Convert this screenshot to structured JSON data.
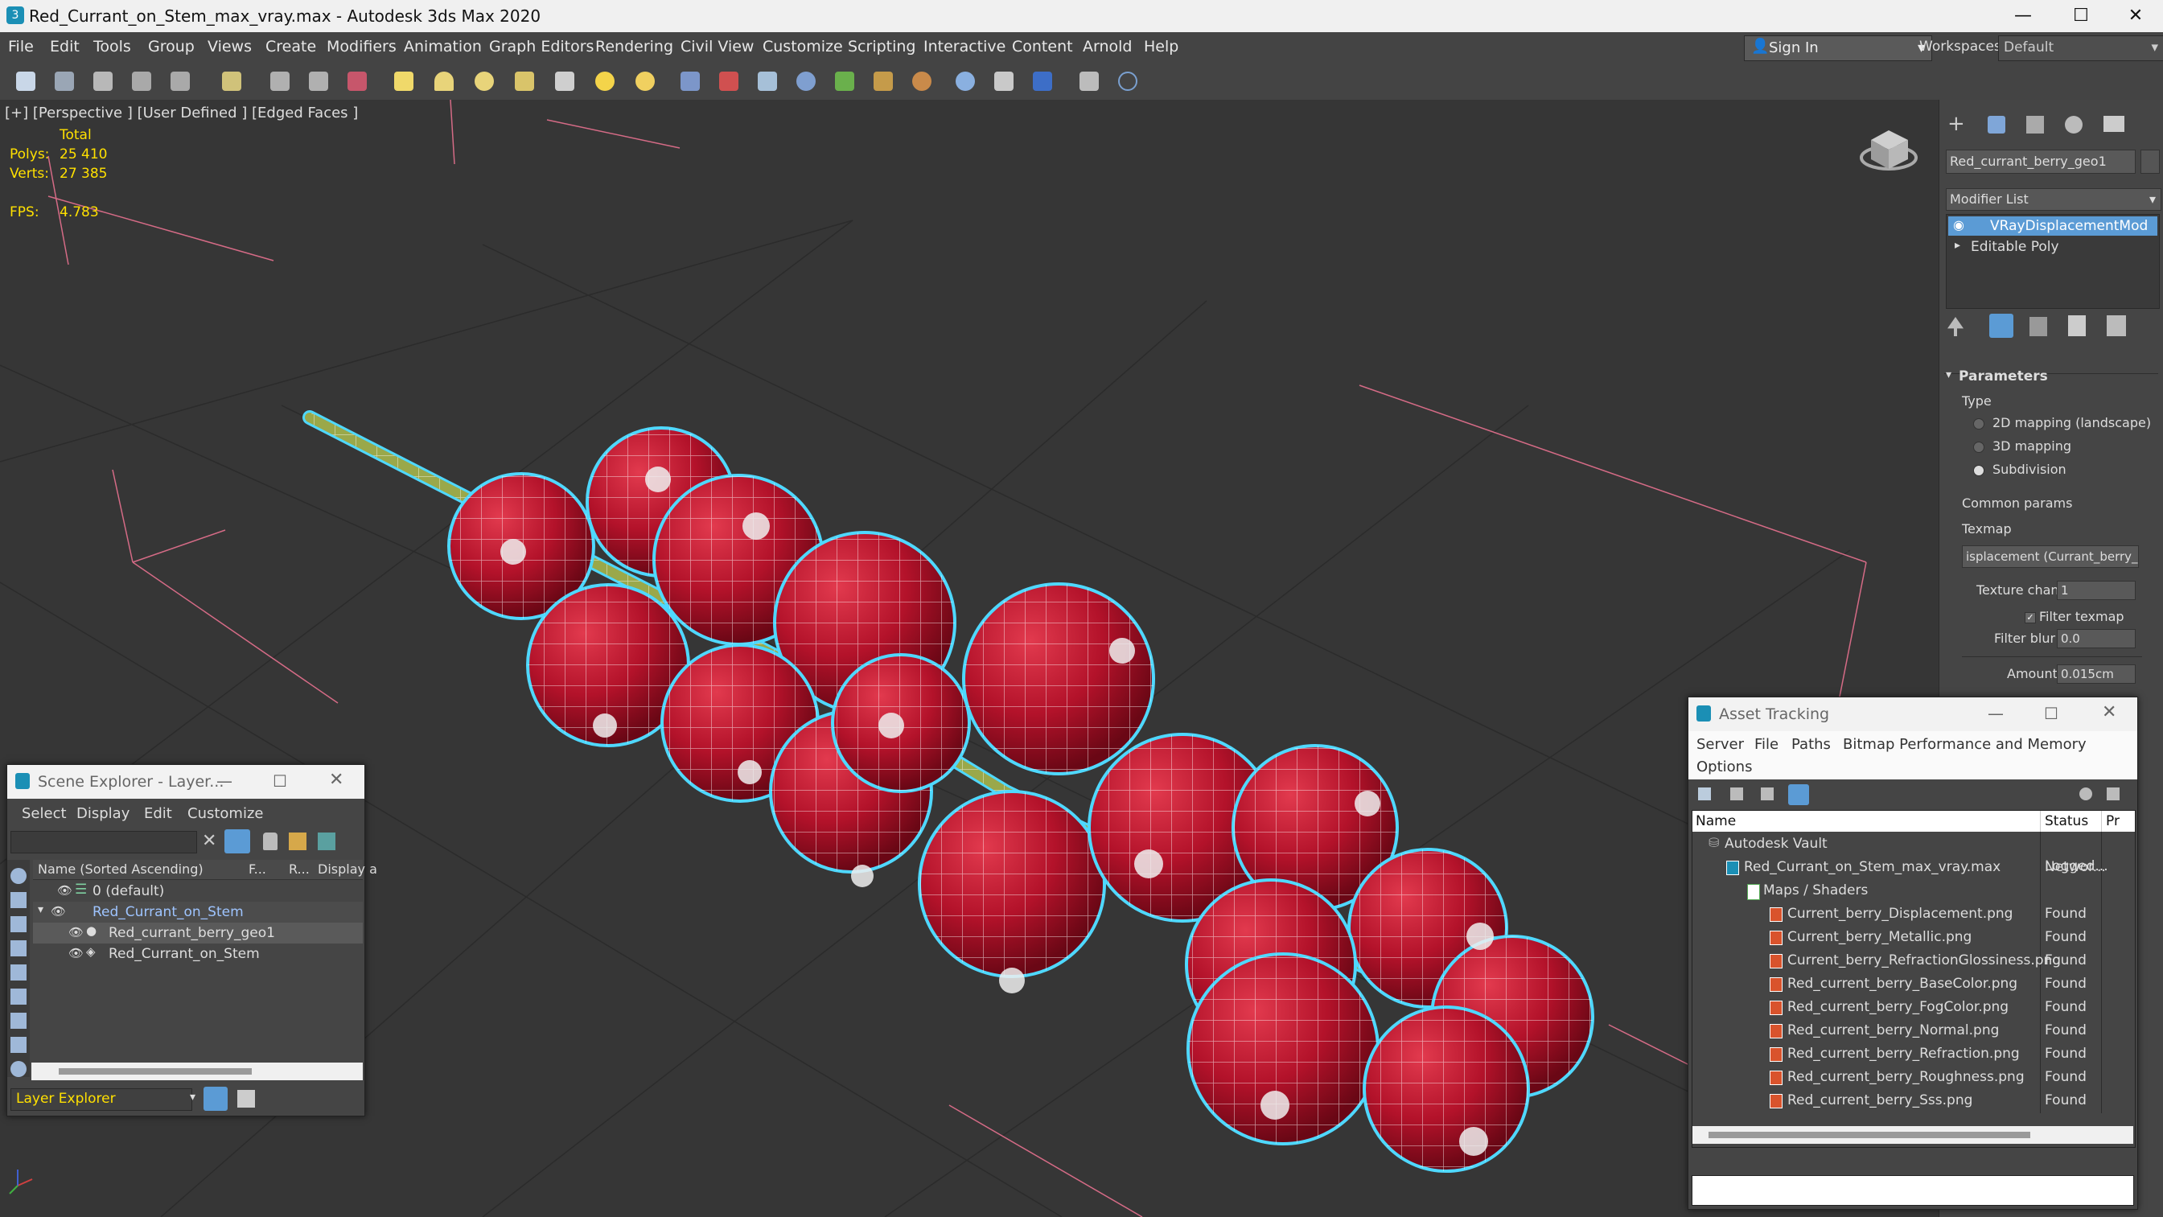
{
  "window": {
    "title": "Red_Currant_on_Stem_max_vray.max - Autodesk 3ds Max 2020",
    "minimize": "—",
    "maximize": "☐",
    "close": "✕"
  },
  "menu": [
    "File",
    "Edit",
    "Tools",
    "Group",
    "Views",
    "Create",
    "Modifiers",
    "Animation",
    "Graph Editors",
    "Rendering",
    "Civil View",
    "Customize",
    "Scripting",
    "Interactive",
    "Content",
    "Arnold",
    "Help"
  ],
  "signin": {
    "label": "Sign In",
    "arrow": "▾"
  },
  "workspaces": {
    "label": "Workspaces:",
    "value": "Default"
  },
  "viewport": {
    "label": "[+] [Perspective ] [User Defined ] [Edged Faces ]",
    "stats": {
      "total_label": "Total",
      "polys_label": "Polys:",
      "polys": "25 410",
      "verts_label": "Verts:",
      "verts": "27 385",
      "fps_label": "FPS:",
      "fps": "4.783"
    }
  },
  "command_panel": {
    "object_name": "Red_currant_berry_geo1",
    "modifier_list_label": "Modifier List",
    "stack": [
      "VRayDisplacementMod",
      "Editable Poly"
    ],
    "parameters_title": "Parameters",
    "type_label": "Type",
    "type_options": [
      "2D mapping (landscape)",
      "3D mapping",
      "Subdivision"
    ],
    "type_selected": "Subdivision",
    "common_params": "Common params",
    "texmap_label": "Texmap",
    "texmap_value": "isplacement (Currant_berry_D",
    "texture_chan_label": "Texture chan",
    "texture_chan_value": "1",
    "filter_texmap_label": "Filter texmap",
    "filter_blur_label": "Filter blur",
    "filter_blur_value": "0.0",
    "amount_label": "Amount",
    "amount_value": "0.015cm"
  },
  "scene_explorer": {
    "title": "Scene Explorer - Layer...",
    "menu": [
      "Select",
      "Display",
      "Edit",
      "Customize"
    ],
    "columns": [
      "Name (Sorted Ascending)",
      "F...",
      "R...",
      "Display a"
    ],
    "rows": [
      {
        "label": "0 (default)"
      },
      {
        "label": "Red_Currant_on_Stem"
      },
      {
        "label": "Red_currant_berry_geo1"
      },
      {
        "label": "Red_Currant_on_Stem"
      }
    ],
    "footer": "Layer Explorer"
  },
  "asset_tracking": {
    "title": "Asset Tracking",
    "menu": [
      "Server",
      "File",
      "Paths",
      "Bitmap Performance and Memory",
      "Options"
    ],
    "columns": [
      "Name",
      "Status",
      "Pr"
    ],
    "rows": [
      {
        "name": "Autodesk Vault",
        "status": "Logged..."
      },
      {
        "name": "Red_Currant_on_Stem_max_vray.max",
        "status": "Networ..."
      },
      {
        "name": "Maps / Shaders",
        "status": ""
      },
      {
        "name": "Current_berry_Displacement.png",
        "status": "Found"
      },
      {
        "name": "Current_berry_Metallic.png",
        "status": "Found"
      },
      {
        "name": "Current_berry_RefractionGlossiness.png",
        "status": "Found"
      },
      {
        "name": "Red_current_berry_BaseColor.png",
        "status": "Found"
      },
      {
        "name": "Red_current_berry_FogColor.png",
        "status": "Found"
      },
      {
        "name": "Red_current_berry_Normal.png",
        "status": "Found"
      },
      {
        "name": "Red_current_berry_Refraction.png",
        "status": "Found"
      },
      {
        "name": "Red_current_berry_Roughness.png",
        "status": "Found"
      },
      {
        "name": "Red_current_berry_Sss.png",
        "status": "Found"
      }
    ]
  },
  "colors": {
    "accent": "#5b9bd5",
    "selection_outline": "#4fd8ff",
    "berry": "#b3122a",
    "stat_text": "#ffe000"
  }
}
